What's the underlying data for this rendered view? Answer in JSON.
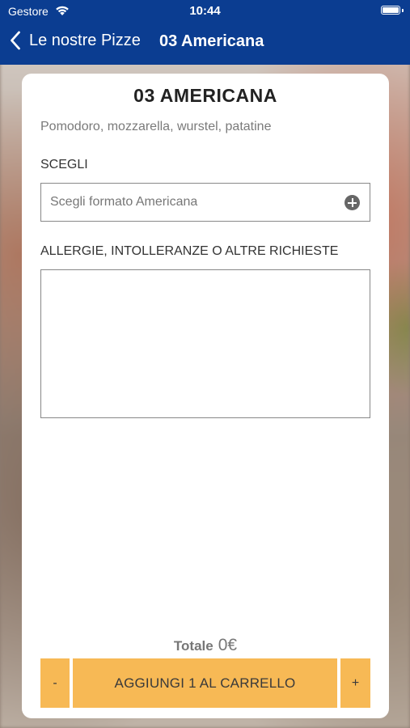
{
  "status_bar": {
    "carrier": "Gestore",
    "time": "10:44"
  },
  "nav": {
    "back_label": "Le nostre Pizze",
    "title": "03 Americana"
  },
  "product": {
    "title": "03 AMERICANA",
    "description": "Pomodoro, mozzarella, wurstel, patatine"
  },
  "choose": {
    "label": "SCEGLI",
    "placeholder": "Scegli formato Americana"
  },
  "notes": {
    "label": "ALLERGIE, INTOLLERANZE O ALTRE RICHIESTE",
    "value": ""
  },
  "total": {
    "label": "Totale",
    "value": "0€"
  },
  "cart": {
    "minus_label": "-",
    "add_label": "AGGIUNGI 1 AL CARRELLO",
    "plus_label": "+",
    "button_color": "#f7b955"
  },
  "colors": {
    "header": "#0b3d91"
  },
  "icons": {
    "wifi": "wifi-icon",
    "battery": "battery-icon",
    "back": "chevron-left-icon",
    "add": "plus-circle-icon"
  }
}
